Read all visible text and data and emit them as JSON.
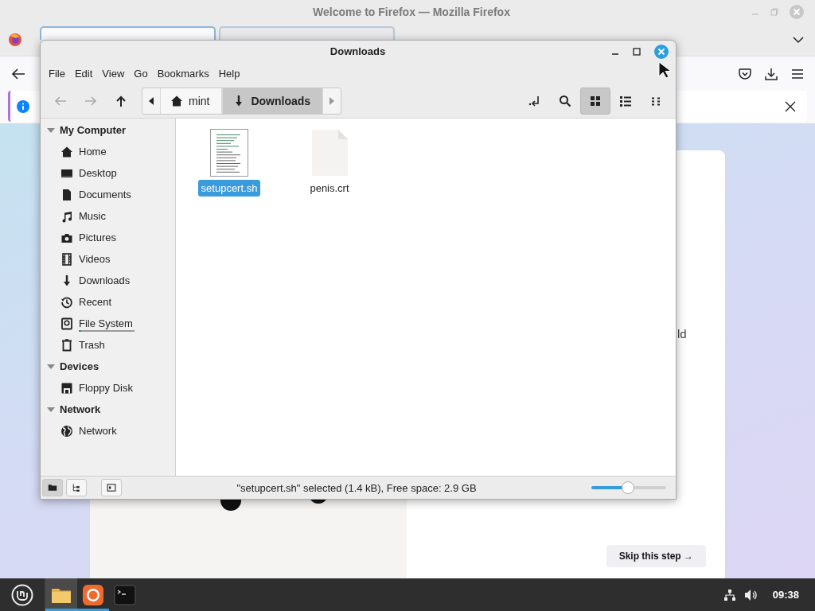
{
  "firefox": {
    "title": "Welcome to Firefox — Mozilla Firefox",
    "tabs": [
      {
        "selected": true
      },
      {
        "selected": false
      }
    ],
    "page": {
      "text": "ld",
      "button": "Skip this step →"
    }
  },
  "file_manager": {
    "title": "Downloads",
    "menu": [
      "File",
      "Edit",
      "View",
      "Go",
      "Bookmarks",
      "Help"
    ],
    "path": [
      {
        "label": "mint",
        "kind": "home",
        "selected": false
      },
      {
        "label": "Downloads",
        "kind": "downloads",
        "selected": true
      }
    ],
    "views": [
      {
        "kind": "icons",
        "selected": true
      },
      {
        "kind": "list",
        "selected": false
      },
      {
        "kind": "compact",
        "selected": false
      }
    ],
    "sidebar": [
      {
        "heading": "My Computer",
        "expanded": true,
        "items": [
          {
            "label": "Home",
            "kind": "home"
          },
          {
            "label": "Desktop",
            "kind": "desktop"
          },
          {
            "label": "Documents",
            "kind": "documents"
          },
          {
            "label": "Music",
            "kind": "music"
          },
          {
            "label": "Pictures",
            "kind": "pictures"
          },
          {
            "label": "Videos",
            "kind": "videos"
          },
          {
            "label": "Downloads",
            "kind": "downloads"
          },
          {
            "label": "Recent",
            "kind": "recent"
          },
          {
            "label": "File System",
            "kind": "filesystem",
            "level": 0.05
          },
          {
            "label": "Trash",
            "kind": "trash"
          }
        ]
      },
      {
        "heading": "Devices",
        "expanded": true,
        "items": [
          {
            "label": "Floppy Disk",
            "kind": "floppy"
          }
        ]
      },
      {
        "heading": "Network",
        "expanded": true,
        "items": [
          {
            "label": "Network",
            "kind": "network"
          }
        ]
      }
    ],
    "files": [
      {
        "name": "setupcert.sh",
        "kind": "text",
        "selected": true
      },
      {
        "name": "penis.crt",
        "kind": "blank",
        "selected": false
      }
    ],
    "pane_buttons": [
      {
        "kind": "places",
        "selected": true
      },
      {
        "kind": "tree",
        "selected": false
      }
    ],
    "status": "\"setupcert.sh\" selected (1.4 kB), Free space: 2.9 GB",
    "zoom": {
      "level": 0.49
    }
  },
  "taskbar": {
    "apps": [
      {
        "kind": "files",
        "running": true,
        "focused": true
      },
      {
        "kind": "firefox",
        "running": true,
        "focused": false
      },
      {
        "kind": "terminal",
        "running": false,
        "focused": false
      }
    ],
    "clock": "09:38"
  }
}
